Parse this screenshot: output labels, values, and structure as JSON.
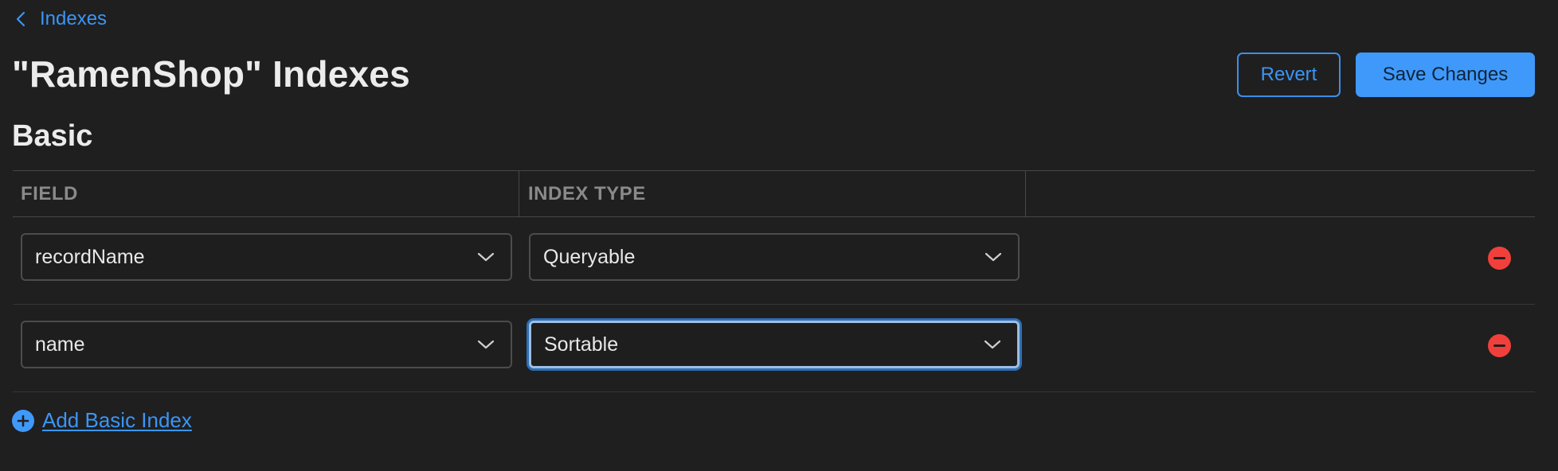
{
  "nav": {
    "back_label": "Indexes"
  },
  "header": {
    "title": "\"RamenShop\" Indexes",
    "revert_label": "Revert",
    "save_label": "Save Changes"
  },
  "section": {
    "title": "Basic"
  },
  "table": {
    "columns": [
      "FIELD",
      "INDEX TYPE"
    ],
    "rows": [
      {
        "field": "recordName",
        "index_type": "Queryable",
        "focused": false
      },
      {
        "field": "name",
        "index_type": "Sortable",
        "focused": true
      }
    ]
  },
  "add_index_label": "Add Basic Index",
  "colors": {
    "accent": "#3f99fb",
    "remove": "#f1403b",
    "background": "#1f1f1f"
  },
  "icons": {
    "back": "chevron-left-icon",
    "dropdown": "chevron-down-icon",
    "remove": "minus-circle-icon",
    "add": "plus-circle-icon"
  }
}
